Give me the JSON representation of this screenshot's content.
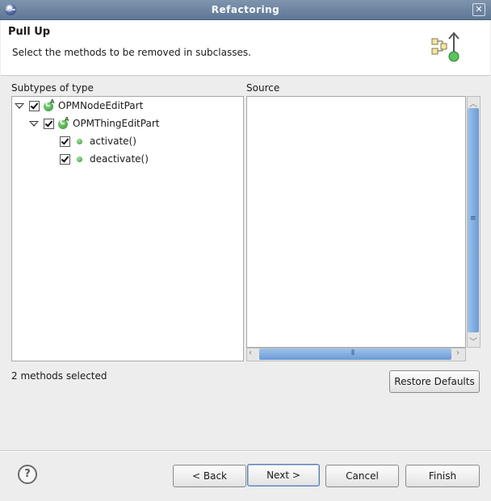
{
  "window": {
    "title": "Refactoring"
  },
  "header": {
    "title": "Pull Up",
    "description": "Select the methods to be removed in subclasses."
  },
  "left_panel": {
    "label": "Subtypes of type",
    "tree": [
      {
        "label": "OPMNodeEditPart",
        "kind": "class",
        "checked": true,
        "expanded": true
      },
      {
        "label": "OPMThingEditPart",
        "kind": "class",
        "checked": true,
        "expanded": true
      },
      {
        "label": "activate()",
        "kind": "method",
        "checked": true
      },
      {
        "label": "deactivate()",
        "kind": "method",
        "checked": true
      }
    ]
  },
  "right_panel": {
    "label": "Source"
  },
  "status": {
    "text": "2 methods selected"
  },
  "buttons": {
    "restore_defaults": "Restore Defaults",
    "back": "< Back",
    "next": "Next >",
    "cancel": "Cancel",
    "finish": "Finish"
  },
  "icons": {
    "app": "eclipse-icon",
    "close": "close-icon",
    "header": "pull-up-wizard-icon",
    "help": "help-icon"
  },
  "colors": {
    "titlebar": "#6f86a3",
    "scrollbar_thumb": "#7fa8da",
    "method_icon": "#3aa03a"
  }
}
